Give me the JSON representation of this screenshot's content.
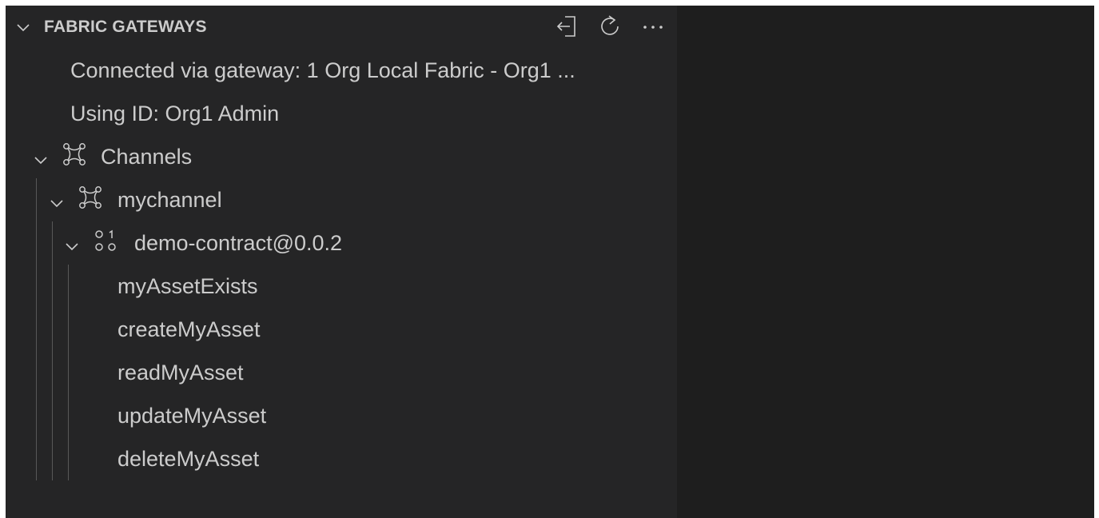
{
  "section": {
    "title": "FABRIC GATEWAYS",
    "actions": [
      {
        "name": "disconnect",
        "icon": "disconnect-icon"
      },
      {
        "name": "refresh",
        "icon": "refresh-icon"
      },
      {
        "name": "more",
        "icon": "more-icon"
      }
    ]
  },
  "tree": {
    "connected_label": "Connected via gateway: 1 Org Local Fabric - Org1 ...",
    "identity_label": "Using ID: Org1 Admin",
    "channels": {
      "label": "Channels",
      "icon": "channels-icon",
      "channel": {
        "label": "mychannel",
        "icon": "channel-icon",
        "contract": {
          "label": "demo-contract@0.0.2",
          "icon": "contract-icon",
          "transactions": [
            "myAssetExists",
            "createMyAsset",
            "readMyAsset",
            "updateMyAsset",
            "deleteMyAsset"
          ]
        }
      }
    }
  },
  "colors": {
    "panel_background": "#252526",
    "editor_background": "#1e1e1e",
    "foreground": "#cccccc",
    "indent_guide": "#585858"
  }
}
